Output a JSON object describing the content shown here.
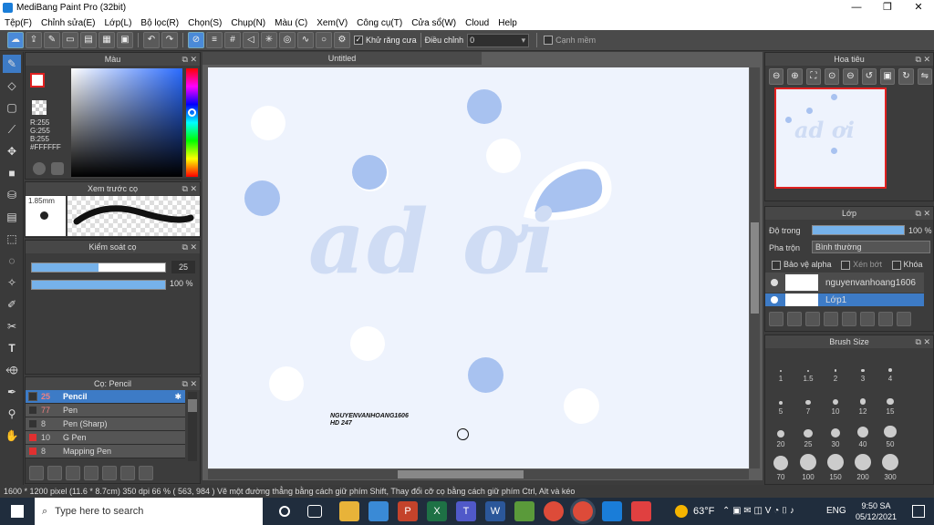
{
  "window": {
    "title": "MediBang Paint Pro (32bit)",
    "min": "—",
    "max": "❐",
    "close": "✕"
  },
  "menu": [
    "Tệp(F)",
    "Chỉnh sửa(E)",
    "Lớp(L)",
    "Bộ lọc(R)",
    "Chọn(S)",
    "Chụp(N)",
    "Màu (C)",
    "Xem(V)",
    "Công cụ(T)",
    "Cửa sổ(W)",
    "Cloud",
    "Help"
  ],
  "toolbar": {
    "antialias": "Khử răng cưa",
    "adjust": "Điều chỉnh",
    "adjust_value": "0",
    "edge": "Cạnh mềm"
  },
  "color_panel": {
    "title": "Màu",
    "r": "R:255",
    "g": "G:255",
    "b": "B:255",
    "hex": "#FFFFFF"
  },
  "preview_panel": {
    "title": "Xem trước cọ",
    "size": "1.85mm"
  },
  "brush_control": {
    "title": "Kiểm soát cọ",
    "size": "25",
    "opacity": "100 %"
  },
  "brush_panel": {
    "title": "Cọ: Pencil",
    "items": [
      {
        "num": "25",
        "name": "Pencil",
        "color": "#333",
        "sel": true
      },
      {
        "num": "77",
        "name": "Pen",
        "color": "#333",
        "sel": false
      },
      {
        "num": "8",
        "name": "Pen (Sharp)",
        "color": "#333",
        "sel": false
      },
      {
        "num": "10",
        "name": "G Pen",
        "color": "#e03030",
        "sel": false
      },
      {
        "num": "8",
        "name": "Mapping Pen",
        "color": "#e03030",
        "sel": false
      }
    ]
  },
  "canvas": {
    "tab": "Untitled",
    "text_main": "ad ơi",
    "sig1": "NGUYENVANHOANG1606",
    "sig2": "HD 247"
  },
  "navigator": {
    "title": "Hoa tiêu"
  },
  "layer_panel": {
    "title": "Lớp",
    "opacity_label": "Độ trong",
    "opacity": "100 %",
    "blend_label": "Pha trộn",
    "blend": "Bình thường",
    "protect": "Bảo vệ alpha",
    "clip": "Xén bớt",
    "lock": "Khóa",
    "layer1": "nguyenvanhoang1606",
    "layer2": "Lớp1"
  },
  "brush_size": {
    "title": "Brush Size",
    "sizes": [
      "1",
      "1.5",
      "2",
      "3",
      "4",
      "5",
      "7",
      "10",
      "12",
      "15",
      "20",
      "25",
      "30",
      "40",
      "50",
      "70",
      "100",
      "150",
      "200",
      "300"
    ]
  },
  "status": {
    "text": "1600 * 1200 pixel   (11.6 * 8.7cm)   350 dpi   66 %   ( 563, 984 )   Vẽ một đường thẳng bằng cách giữ phím Shift, Thay đổi cỡ cọ bằng cách giữ phím Ctrl, Alt và kéo"
  },
  "taskbar": {
    "search": "Type here to search",
    "weather": "63°F",
    "lang": "ENG",
    "time": "9:50 SA",
    "date": "05/12/2021"
  }
}
